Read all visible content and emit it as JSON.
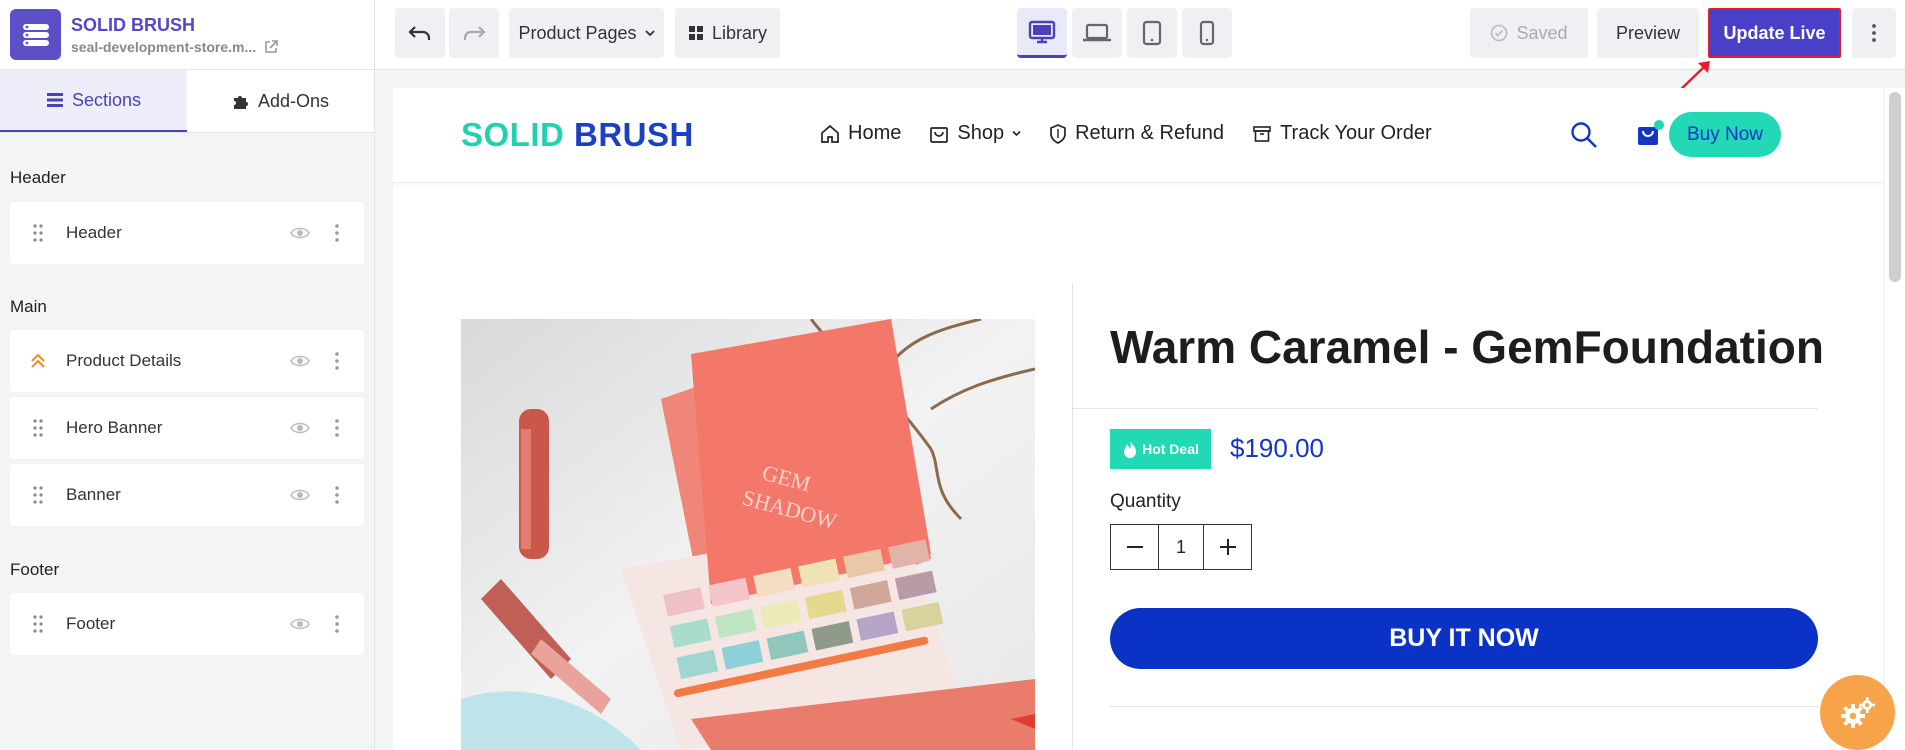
{
  "app": {
    "title": "SOLID BRUSH",
    "store_url": "seal-development-store.m..."
  },
  "sidebar": {
    "tabs": [
      {
        "label": "Sections",
        "icon": "sections-icon",
        "active": true
      },
      {
        "label": "Add-Ons",
        "icon": "puzzle-icon",
        "active": false
      }
    ],
    "groups": [
      {
        "title": "Header",
        "items": [
          {
            "label": "Header"
          }
        ]
      },
      {
        "title": "Main",
        "items": [
          {
            "label": "Product Details"
          },
          {
            "label": "Hero Banner"
          },
          {
            "label": "Banner"
          }
        ]
      },
      {
        "title": "Footer",
        "items": [
          {
            "label": "Footer"
          }
        ]
      }
    ]
  },
  "toolbar": {
    "page_selector": "Product Pages",
    "library": "Library",
    "devices": [
      "desktop-icon",
      "laptop-icon",
      "tablet-icon",
      "mobile-icon"
    ],
    "active_device": "desktop-icon",
    "saved": "Saved",
    "preview": "Preview",
    "update_live": "Update Live"
  },
  "site": {
    "logo_part1": "SOLID",
    "logo_part2": "BRUSH",
    "nav": [
      {
        "label": "Home",
        "icon": "home-icon"
      },
      {
        "label": "Shop",
        "icon": "bag-icon",
        "dropdown": true
      },
      {
        "label": "Return & Refund",
        "icon": "shield-icon"
      },
      {
        "label": "Track Your Order",
        "icon": "box-icon"
      }
    ],
    "buy_now": "Buy Now"
  },
  "product": {
    "title": "Warm Caramel - GemFoundation",
    "badge": "Hot Deal",
    "price": "$190.00",
    "quantity_label": "Quantity",
    "quantity": "1",
    "buy_it_now": "BUY IT NOW",
    "image_text_1": "GEM",
    "image_text_2": "SHADOW"
  },
  "colors": {
    "brand": "#4a3fc7",
    "teal": "#22d8b5",
    "blue": "#0a32c4",
    "highlight": "#e51c2a"
  }
}
